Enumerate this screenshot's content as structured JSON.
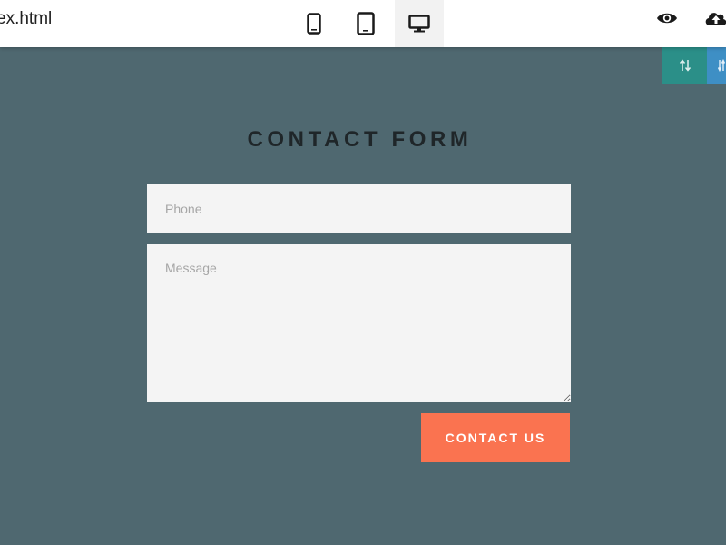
{
  "topbar": {
    "filename": "ex.html",
    "devices": [
      {
        "name": "mobile",
        "icon": "phone-icon"
      },
      {
        "name": "tablet",
        "icon": "tablet-icon"
      },
      {
        "name": "desktop",
        "icon": "desktop-icon",
        "active": true
      }
    ],
    "actions": [
      {
        "icon": "eye-icon"
      },
      {
        "icon": "cloud-upload-icon"
      }
    ]
  },
  "floating_tools": [
    {
      "icon": "sort-arrows-icon",
      "color": "#2b8f88"
    },
    {
      "icon": "arrows-icon",
      "color": "#3e8fc5"
    }
  ],
  "form": {
    "title": "CONTACT FORM",
    "phone_placeholder": "Phone",
    "message_placeholder": "Message",
    "submit_label": "CONTACT US"
  },
  "colors": {
    "background": "#4f6870",
    "field_bg": "#f4f4f4",
    "submit": "#fa7350"
  }
}
